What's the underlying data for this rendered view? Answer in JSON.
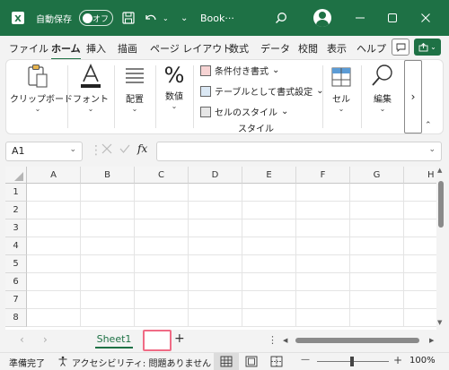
{
  "titlebar": {
    "autosave_label": "自動保存",
    "autosave_state": "オフ",
    "filename": "Book···",
    "colors": {
      "bg": "#1e7145",
      "fg": "#ffffff"
    }
  },
  "tabs": [
    "ファイル",
    "ホーム",
    "挿入",
    "描画",
    "ページ レイアウト",
    "数式",
    "データ",
    "校閲",
    "表示",
    "ヘルプ"
  ],
  "ribbon": {
    "clipboard": "クリップボード",
    "font": "フォント",
    "alignment": "配置",
    "number": "数値",
    "conditional_format": "条件付き書式",
    "format_as_table": "テーブルとして書式設定",
    "cell_styles": "セルのスタイル",
    "styles_group": "スタイル",
    "cells": "セル",
    "editing": "編集",
    "more": "›"
  },
  "formula_bar": {
    "name_box": "A1",
    "fx": "fx",
    "formula": ""
  },
  "grid": {
    "columns": [
      "A",
      "B",
      "C",
      "D",
      "E",
      "F",
      "G",
      "H"
    ],
    "rows": [
      "1",
      "2",
      "3",
      "4",
      "5",
      "6",
      "7",
      "8"
    ]
  },
  "sheets": {
    "tabs": [
      "Sheet1"
    ],
    "active": "Sheet1",
    "new_sheet": "+",
    "menu": "⋮"
  },
  "status": {
    "ready": "準備完了",
    "accessibility": "アクセシビリティ: 問題ありません",
    "zoom": "100%",
    "zoom_out": "—",
    "zoom_in": "+"
  }
}
